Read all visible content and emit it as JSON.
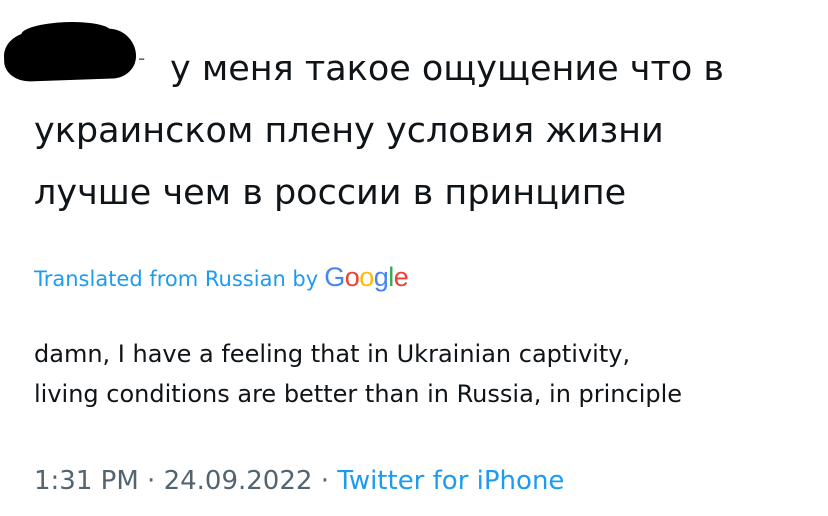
{
  "tweet": {
    "original_lines": [
      "у меня такое ощущение что в",
      "украинском плену условия жизни",
      "лучше чем в россии в принципе"
    ],
    "translated_label": "Translated from Russian by",
    "google_letters": [
      "G",
      "o",
      "o",
      "g",
      "l",
      "e"
    ],
    "translation_lines": [
      "damn, I have a feeling that in Ukrainian captivity,",
      "living conditions are better than in Russia, in principle"
    ],
    "time": "1:31 PM",
    "separator": "·",
    "date": "24.09.2022",
    "source": "Twitter for iPhone"
  },
  "colors": {
    "link_blue": "#1d9bf0",
    "meta_gray": "#536471",
    "text": "#0f1419",
    "google_blue": "#4285f4",
    "google_red": "#ea4335",
    "google_yellow": "#fbbc05",
    "google_green": "#34a853"
  }
}
